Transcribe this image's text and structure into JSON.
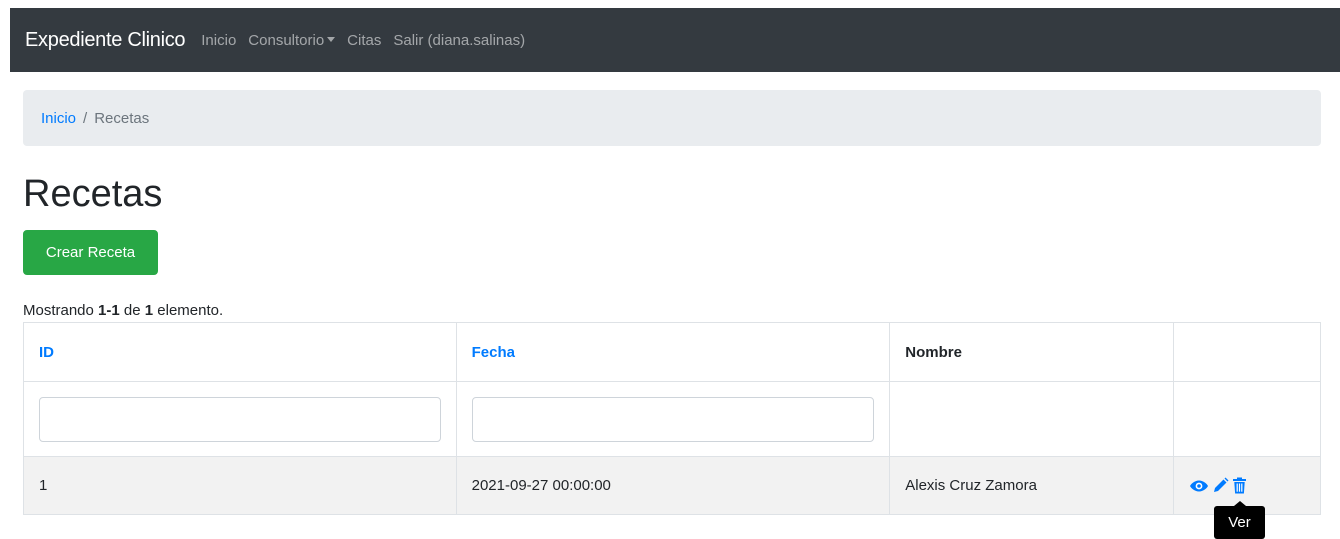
{
  "navbar": {
    "brand": "Expediente Clinico",
    "links": [
      "Inicio",
      "Consultorio",
      "Citas",
      "Salir (diana.salinas)"
    ],
    "dropdown_index": 1
  },
  "breadcrumb": {
    "home": "Inicio",
    "separator": "/",
    "current": "Recetas"
  },
  "page": {
    "title": "Recetas",
    "create_button": "Crear Receta"
  },
  "summary": {
    "prefix": "Mostrando ",
    "range": "1-1",
    "middle": " de ",
    "total": "1",
    "suffix": " elemento."
  },
  "table": {
    "columns": [
      "ID",
      "Fecha",
      "Nombre",
      ""
    ],
    "filters": {
      "id": "",
      "fecha": ""
    },
    "rows": [
      {
        "id": "1",
        "fecha": "2021-09-27 00:00:00",
        "nombre": "Alexis Cruz Zamora"
      }
    ],
    "actions": [
      "eye-icon",
      "pencil-icon",
      "trash-icon"
    ]
  },
  "tooltip": {
    "text": "Ver"
  },
  "colors": {
    "navbar_bg": "#343a40",
    "link": "#007bff",
    "success": "#28a745",
    "breadcrumb_bg": "#e9ecef"
  }
}
